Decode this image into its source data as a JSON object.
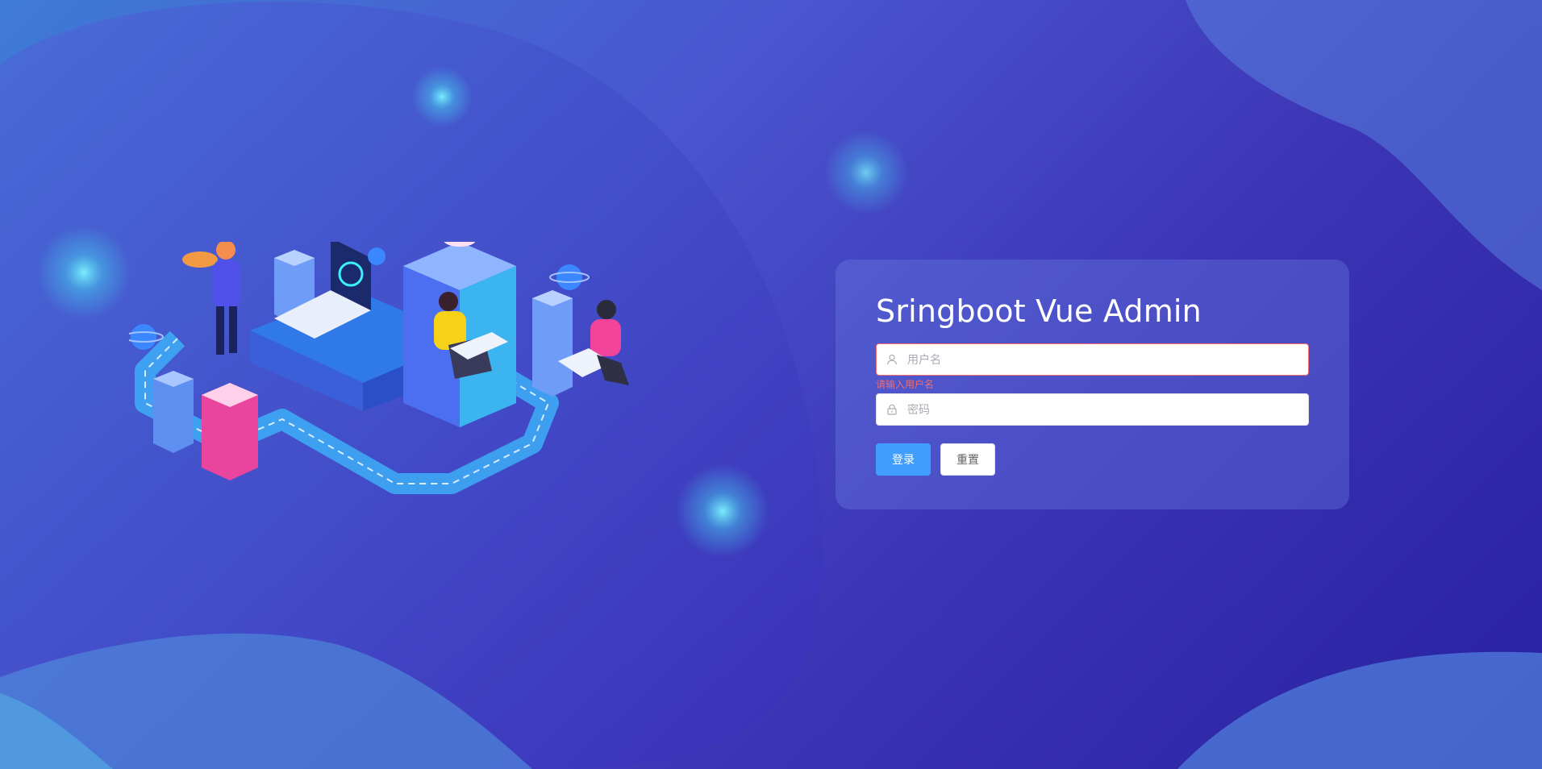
{
  "login": {
    "title": "Sringboot Vue Admin",
    "username": {
      "placeholder": "用户名",
      "value": "",
      "error": "请输入用户名",
      "icon": "user-icon"
    },
    "password": {
      "placeholder": "密码",
      "value": "",
      "icon": "lock-icon"
    },
    "buttons": {
      "login": "登录",
      "reset": "重置"
    }
  },
  "colors": {
    "primary": "#409eff",
    "error": "#f56c6c",
    "background_start": "#3f7bd6",
    "background_end": "#2720a0"
  }
}
